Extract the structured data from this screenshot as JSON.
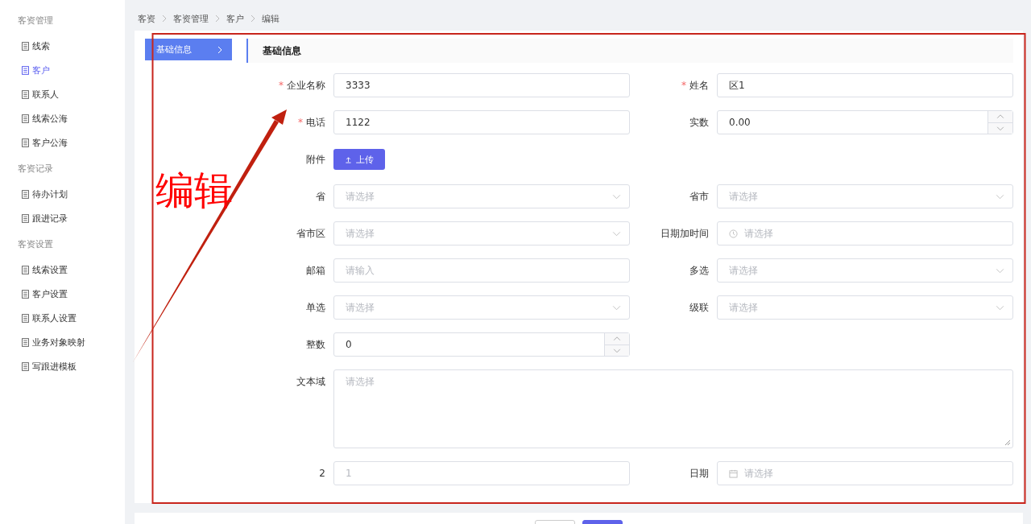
{
  "sidebar": {
    "groups": [
      {
        "title": "客资管理",
        "items": [
          {
            "label": "线索",
            "selected": false
          },
          {
            "label": "客户",
            "selected": true
          },
          {
            "label": "联系人",
            "selected": false
          },
          {
            "label": "线索公海",
            "selected": false
          },
          {
            "label": "客户公海",
            "selected": false
          }
        ]
      },
      {
        "title": "客资记录",
        "items": [
          {
            "label": "待办计划",
            "selected": false
          },
          {
            "label": "跟进记录",
            "selected": false
          }
        ]
      },
      {
        "title": "客资设置",
        "items": [
          {
            "label": "线索设置",
            "selected": false
          },
          {
            "label": "客户设置",
            "selected": false
          },
          {
            "label": "联系人设置",
            "selected": false
          },
          {
            "label": "业务对象映射",
            "selected": false
          },
          {
            "label": "写跟进模板",
            "selected": false
          }
        ]
      }
    ]
  },
  "breadcrumb": [
    "客资",
    "客资管理",
    "客户",
    "编辑"
  ],
  "side_tabs": [
    {
      "label": "基础信息",
      "selected": true
    }
  ],
  "section_title": "基础信息",
  "required_mark": "*",
  "form_rows": [
    [
      {
        "kind": "text",
        "label": "企业名称",
        "required": true,
        "value": "3333"
      },
      {
        "kind": "text",
        "label": "姓名",
        "required": true,
        "value": "区1"
      }
    ],
    [
      {
        "kind": "text",
        "label": "电话",
        "required": true,
        "value": "1122"
      },
      {
        "kind": "number",
        "label": "实数",
        "required": false,
        "value": "0.00"
      }
    ],
    [
      {
        "kind": "upload",
        "label": "附件",
        "required": false,
        "button": "上传"
      }
    ],
    [
      {
        "kind": "select",
        "label": "省",
        "required": false,
        "placeholder": "请选择"
      },
      {
        "kind": "select",
        "label": "省市",
        "required": false,
        "placeholder": "请选择"
      }
    ],
    [
      {
        "kind": "select",
        "label": "省市区",
        "required": false,
        "placeholder": "请选择"
      },
      {
        "kind": "datetime",
        "label": "日期加时间",
        "required": false,
        "placeholder": "请选择"
      }
    ],
    [
      {
        "kind": "text",
        "label": "邮箱",
        "required": false,
        "placeholder": "请输入"
      },
      {
        "kind": "select",
        "label": "多选",
        "required": false,
        "placeholder": "请选择"
      }
    ],
    [
      {
        "kind": "select",
        "label": "单选",
        "required": false,
        "placeholder": "请选择"
      },
      {
        "kind": "select",
        "label": "级联",
        "required": false,
        "placeholder": "请选择"
      }
    ],
    [
      {
        "kind": "number",
        "label": "整数",
        "required": false,
        "value": "0"
      }
    ],
    [
      {
        "kind": "textarea",
        "label": "文本域",
        "required": false,
        "placeholder": "请选择"
      }
    ],
    [
      {
        "kind": "text",
        "label": "2",
        "required": false,
        "placeholder": "1"
      },
      {
        "kind": "date",
        "label": "日期",
        "required": false,
        "placeholder": "请选择"
      }
    ]
  ],
  "annotation": {
    "text": "编辑"
  }
}
